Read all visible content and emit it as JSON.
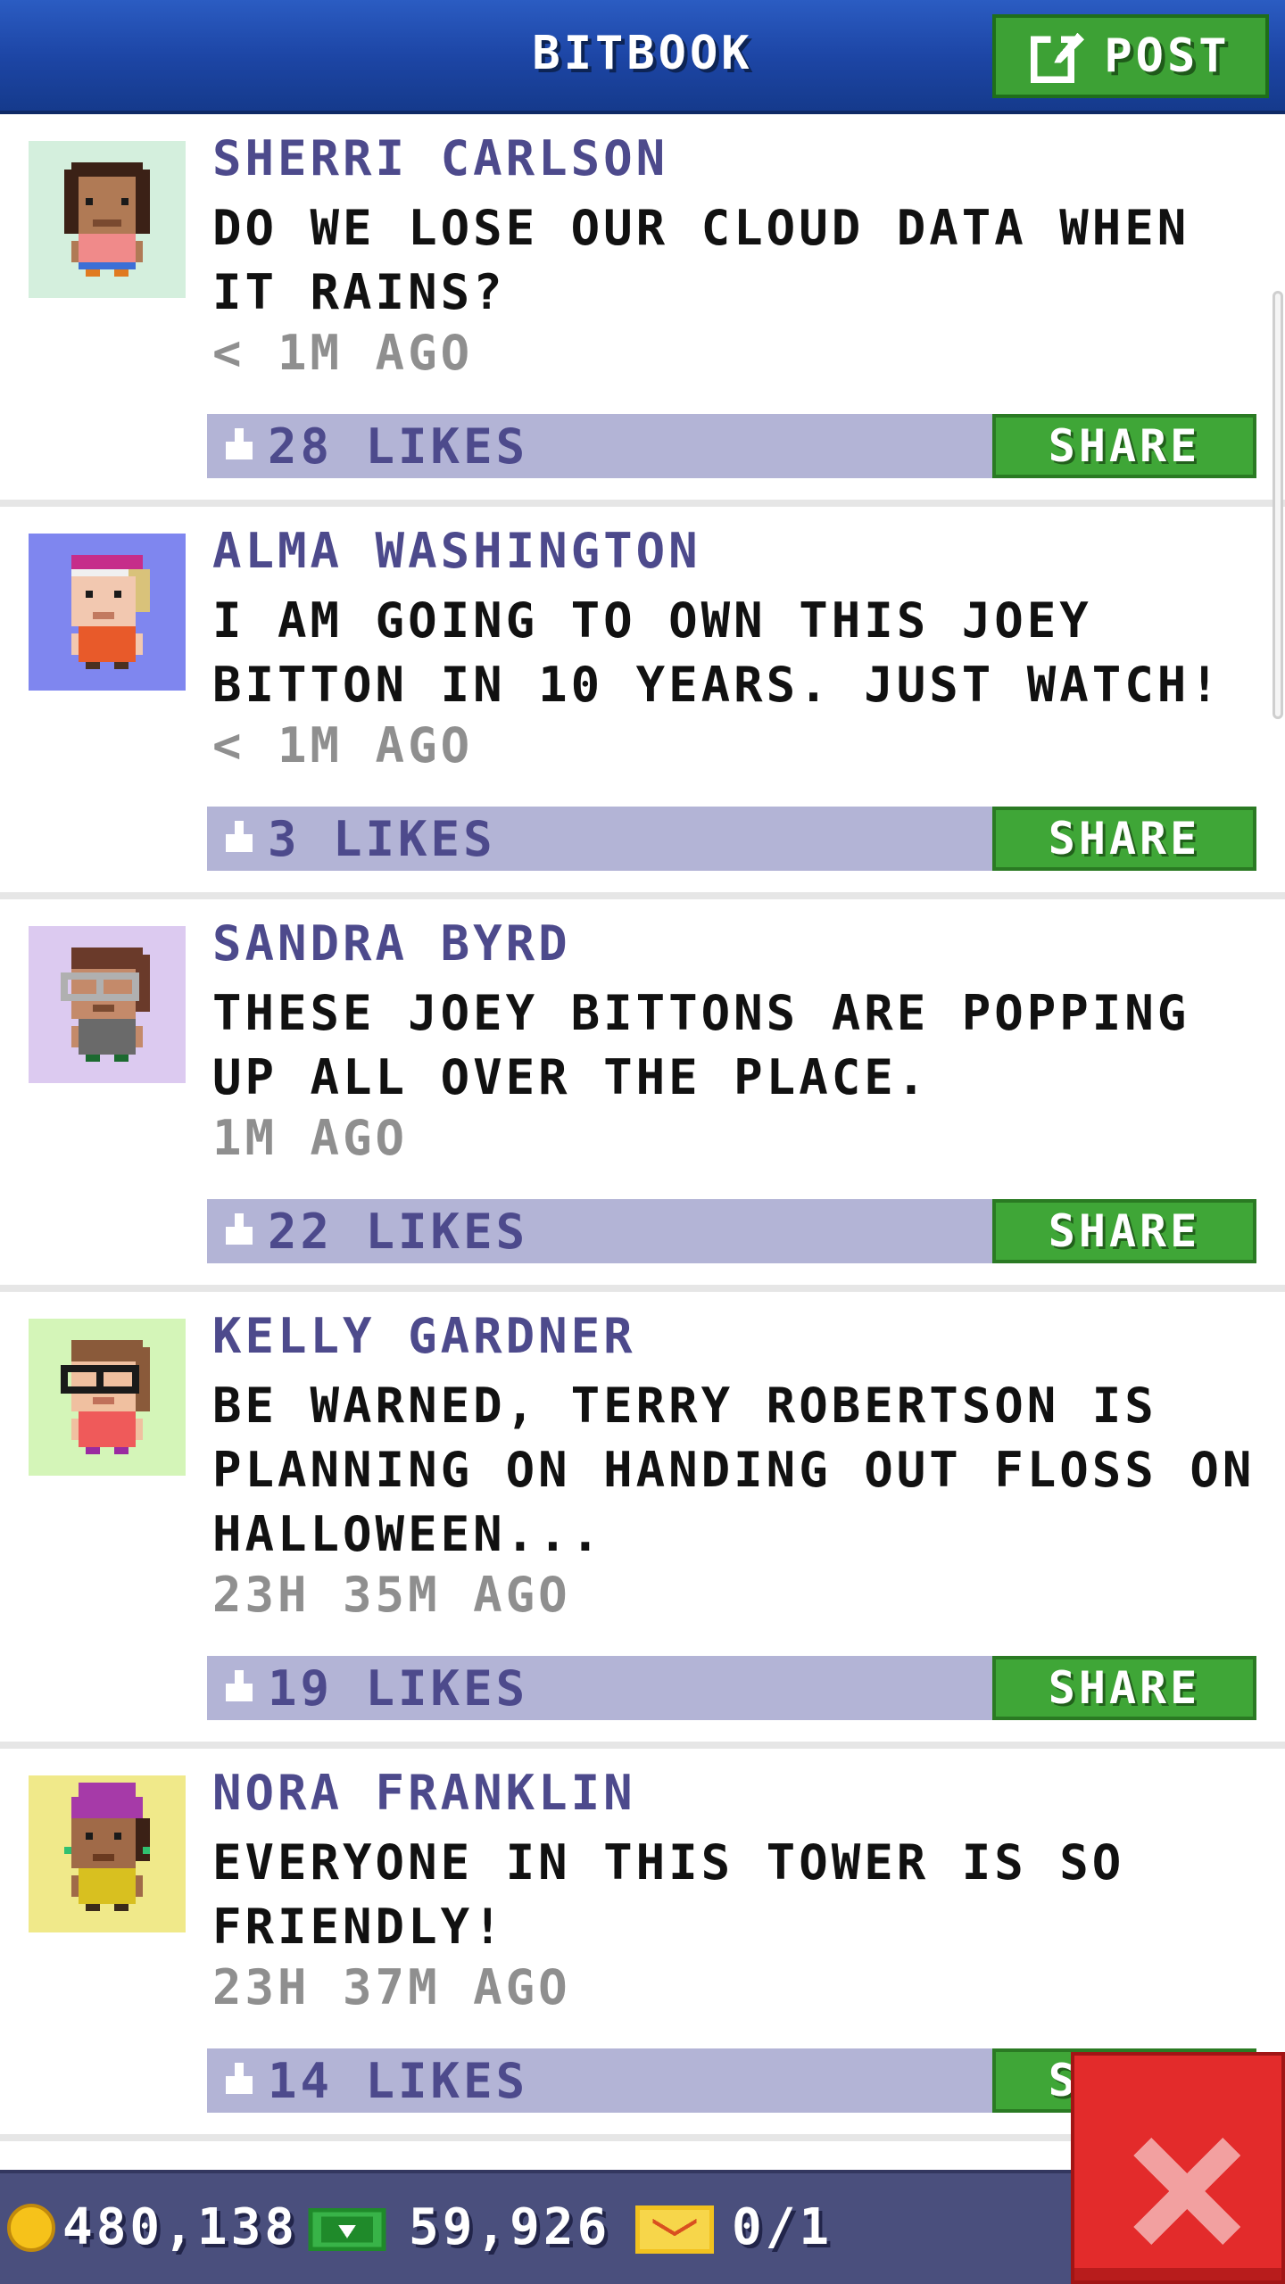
{
  "header": {
    "title": "BITBOOK",
    "post_label": "POST"
  },
  "posts": [
    {
      "author": "SHERRI CARLSON",
      "text": "DO WE LOSE OUR CLOUD DATA WHEN IT RAINS?",
      "time": "< 1M AGO",
      "likes": "28 LIKES",
      "share": "SHARE",
      "avatar_bg": "#d4efdd"
    },
    {
      "author": "ALMA WASHINGTON",
      "text": "I AM GOING TO OWN THIS JOEY BITTON IN 10 YEARS. JUST WATCH!",
      "time": "< 1M AGO",
      "likes": "3 LIKES",
      "share": "SHARE",
      "avatar_bg": "#7f86ef"
    },
    {
      "author": "SANDRA BYRD",
      "text": "THESE JOEY BITTONS ARE POPPING UP ALL OVER THE PLACE.",
      "time": "1M AGO",
      "likes": "22 LIKES",
      "share": "SHARE",
      "avatar_bg": "#dccaf0"
    },
    {
      "author": "KELLY GARDNER",
      "text": "BE WARNED, TERRY ROBERTSON IS PLANNING ON HANDING OUT FLOSS ON HALLOWEEN...",
      "time": "23H 35M AGO",
      "likes": "19 LIKES",
      "share": "SHARE",
      "avatar_bg": "#d4f5b8"
    },
    {
      "author": "NORA FRANKLIN",
      "text": "EVERYONE IN THIS TOWER IS SO FRIENDLY!",
      "time": "23H 37M AGO",
      "likes": "14 LIKES",
      "share": "SHARE",
      "avatar_bg": "#f0e98a"
    }
  ],
  "status": {
    "coins": "480,138",
    "bux": "59,926",
    "tickets": "0/1"
  },
  "icons": {
    "post": "edit-icon",
    "thumb": "thumbs-up-icon",
    "coin": "coin-icon",
    "bux": "bux-icon",
    "ticket": "ticket-icon",
    "close": "close-icon"
  },
  "colors": {
    "header": "#1d46a6",
    "share": "#3fa637",
    "likebar": "#b3b4d6",
    "close": "#e32b2b"
  }
}
